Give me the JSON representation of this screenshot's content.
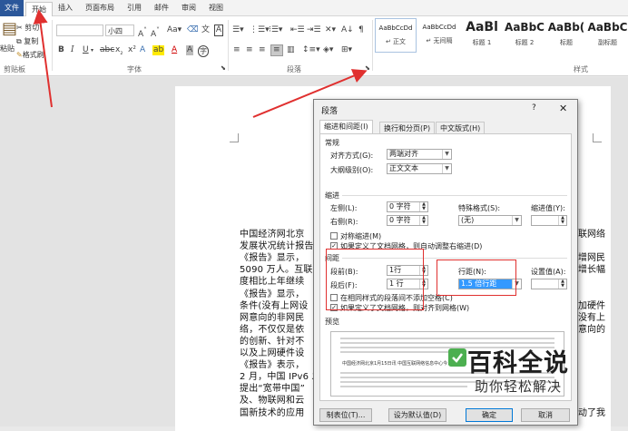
{
  "ribbon": {
    "tabs": {
      "file": "文件",
      "start": "开始",
      "insert": "插入",
      "layout": "页面布局",
      "references": "引用",
      "mail": "邮件",
      "review": "审阅",
      "view": "视图"
    },
    "clipboard": {
      "cut": "剪切",
      "copy": "复制",
      "paste": "粘贴",
      "format_painter": "格式刷",
      "group": "剪贴板"
    },
    "font": {
      "size": "小四",
      "group": "字体"
    },
    "paragraph": {
      "group": "段落"
    },
    "styles": {
      "group": "样式",
      "items": [
        {
          "sample": "AaBbCcDd",
          "name": "正文"
        },
        {
          "sample": "AaBbCcDd",
          "name": "无间隔"
        },
        {
          "sample": "AaBl",
          "name": "标题 1"
        },
        {
          "sample": "AaBbC",
          "name": "标题 2"
        },
        {
          "sample": "AaBb(",
          "name": "标题"
        },
        {
          "sample": "AaBbC",
          "name": "副标题"
        }
      ]
    }
  },
  "document": {
    "lines": [
      "中国经济网北京",
      "发展状况统计报告",
      "《报告》显示，",
      "5090 万人。互联",
      "度相比上年继续",
      "《报告》显示，",
      "条件(没有上网设",
      "网意向的非网民",
      "络，不仅仅是依",
      "的创新、针对不",
      "以及上网硬件设",
      "《报告》表示，",
      "2 月，中国 IPv6 发",
      "提出“宽带中国”",
      "及、物联网和云",
      "国新技术的应用"
    ],
    "right_fragments": [
      {
        "text": "联网络"
      },
      {
        "text": "增网民"
      },
      {
        "text": "增长幅"
      },
      {
        "text": "加硬件"
      },
      {
        "text": "没有上"
      },
      {
        "text": "意向的"
      },
      {
        "text": "动了我"
      }
    ]
  },
  "dialog": {
    "title": "段落",
    "help": "?",
    "close": "✕",
    "tabs": [
      "缩进和间距(I)",
      "换行和分页(P)",
      "中文版式(H)"
    ],
    "general": {
      "section": "常规",
      "alignment_label": "对齐方式(G):",
      "alignment_value": "两端对齐",
      "outline_label": "大纲级别(O):",
      "outline_value": "正文文本"
    },
    "indent": {
      "section": "缩进",
      "left_label": "左侧(L):",
      "left_value": "0 字符",
      "right_label": "右侧(R):",
      "right_value": "0 字符",
      "special_label": "特殊格式(S):",
      "special_value": "(无)",
      "by_label": "缩进值(Y):",
      "mirror_label": "对称缩进(M)",
      "auto_label": "如果定义了文档网格，则自动调整右缩进(D)"
    },
    "spacing": {
      "section": "间距",
      "before_label": "段前(B):",
      "before_value": "1行",
      "after_label": "段后(F):",
      "after_value": "1 行",
      "line_label": "行距(N):",
      "line_value": "1.5 倍行距",
      "at_label": "设置值(A):",
      "no_space_label": "在相同样式的段落间不添加空格(C)",
      "snap_label": "如果定义了文档网格，则对齐到网格(W)"
    },
    "preview": {
      "section": "预览",
      "sample": "中国经济网北京1月15日讯 中国互联网络信息中心今日发布"
    },
    "buttons": {
      "tabs": "制表位(T)...",
      "default": "设为默认值(D)",
      "ok": "确定",
      "cancel": "取消"
    }
  },
  "watermark": {
    "title": "百科全说",
    "subtitle": "助你轻松解决"
  },
  "colors": {
    "accent": "#2b579a",
    "highlight": "#e0302f",
    "selection": "#3399ff"
  }
}
